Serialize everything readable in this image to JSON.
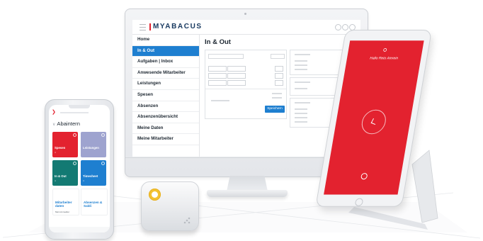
{
  "desktop": {
    "brand": "MYABACUS",
    "page_title": "In & Out",
    "save_label": "Speichern",
    "nav_items": [
      "Home",
      "In & Out",
      "Aufgaben | Inbox",
      "Anwesende Mitarbeiter",
      "Leistungen",
      "Spesen",
      "Absenzen",
      "Absenzenübersicht",
      "Meine Daten",
      "Meine Mitarbeiter"
    ],
    "active_nav": "In & Out"
  },
  "mobile": {
    "title": "Abaintern",
    "tiles": [
      {
        "label": "Spesen",
        "sub": "4",
        "color": "#e3222f"
      },
      {
        "label": "Leistungen",
        "sub": "",
        "color": "#9ea3cf"
      },
      {
        "label": "In & Out",
        "sub": "4",
        "color": "#137a73"
      },
      {
        "label": "Timesheet",
        "sub": "4",
        "color": "#1e7fd0"
      },
      {
        "label": "Mitarbeiter daten",
        "sub": "Mein Anmelder",
        "color": "#ffffff"
      },
      {
        "label": "Absenzen & Saldi",
        "sub": "",
        "color": "#ffffff"
      }
    ]
  },
  "tablet": {
    "greeting": "Hallo Reto Amrein",
    "accent": "#e3222f"
  },
  "colors": {
    "primary_blue": "#1e7fd0",
    "navy": "#17385f",
    "brand_red": "#e3222f",
    "reader_yellow": "#f3c232"
  }
}
